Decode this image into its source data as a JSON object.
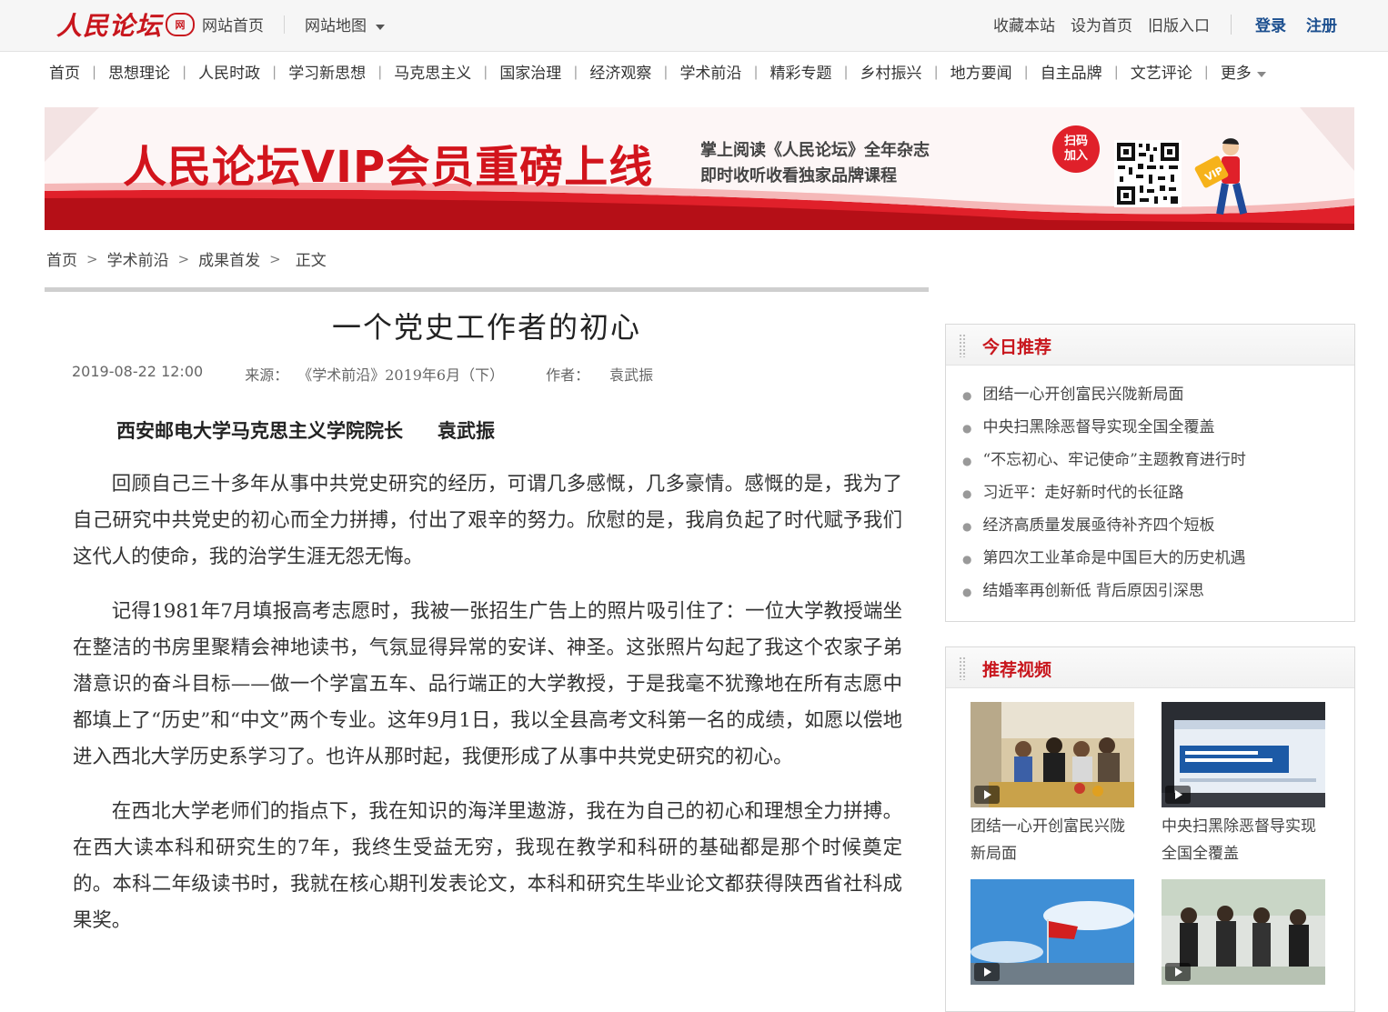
{
  "header": {
    "logo_text": "人民论坛",
    "logo_badge": "网",
    "links_left": [
      "网站首页",
      "网站地图"
    ],
    "links_right": [
      "收藏本站",
      "设为首页",
      "旧版入口"
    ],
    "login": "登录",
    "register": "注册"
  },
  "nav": [
    "首页",
    "思想理论",
    "人民时政",
    "学习新思想",
    "马克思主义",
    "国家治理",
    "经济观察",
    "学术前沿",
    "精彩专题",
    "乡村振兴",
    "地方要闻",
    "自主品牌",
    "文艺评论",
    "更多"
  ],
  "banner": {
    "title": "人民论坛VIP会员重磅上线",
    "sub1": "掌上阅读《人民论坛》全年杂志",
    "sub2": "即时收听收看独家品牌课程",
    "scan1": "扫码",
    "scan2": "加入",
    "vip": "VIP"
  },
  "breadcrumb": [
    "首页",
    "学术前沿",
    "成果首发",
    "正文"
  ],
  "article": {
    "title": "一个党史工作者的初心",
    "date": "2019-08-22 12:00",
    "source_label": "来源：",
    "source": "《学术前沿》2019年6月（下）",
    "author_label": "作者：",
    "author": "袁武振",
    "byline_org": "西安邮电大学马克思主义学院院长",
    "byline_name": "袁武振",
    "paragraphs": [
      "回顾自己三十多年从事中共党史研究的经历，可谓几多感慨，几多豪情。感慨的是，我为了自己研究中共党史的初心而全力拼搏，付出了艰辛的努力。欣慰的是，我肩负起了时代赋予我们这代人的使命，我的治学生涯无怨无悔。",
      "记得1981年7月填报高考志愿时，我被一张招生广告上的照片吸引住了：一位大学教授端坐在整洁的书房里聚精会神地读书，气氛显得异常的安详、神圣。这张照片勾起了我这个农家子弟潜意识的奋斗目标——做一个学富五车、品行端正的大学教授，于是我毫不犹豫地在所有志愿中都填上了“历史”和“中文”两个专业。这年9月1日，我以全县高考文科第一名的成绩，如愿以偿地进入西北大学历史系学习了。也许从那时起，我便形成了从事中共党史研究的初心。",
      "在西北大学老师们的指点下，我在知识的海洋里遨游，我在为自己的初心和理想全力拼搏。在西大读本科和研究生的7年，我终生受益无穷，我现在教学和科研的基础都是那个时候奠定的。本科二年级读书时，我就在核心期刊发表论文，本科和研究生毕业论文都获得陕西省社科成果奖。"
    ]
  },
  "sidebar": {
    "today_title": "今日推荐",
    "today": [
      "团结一心开创富民兴陇新局面",
      "中央扫黑除恶督导实现全国全覆盖",
      "“不忘初心、牢记使命”主题教育进行时",
      "习近平：走好新时代的长征路",
      "经济高质量发展亟待补齐四个短板",
      "第四次工业革命是中国巨大的历史机遇",
      "结婚率再创新低 背后原因引深思"
    ],
    "video_title": "推荐视频",
    "videos": [
      {
        "caption": "团结一心开创富民兴陇新局面"
      },
      {
        "caption": "中央扫黑除恶督导实现全国全覆盖"
      },
      {
        "caption": ""
      },
      {
        "caption": ""
      }
    ]
  },
  "colors": {
    "brand_red": "#c8161d",
    "auth_blue": "#1c4f8f"
  }
}
